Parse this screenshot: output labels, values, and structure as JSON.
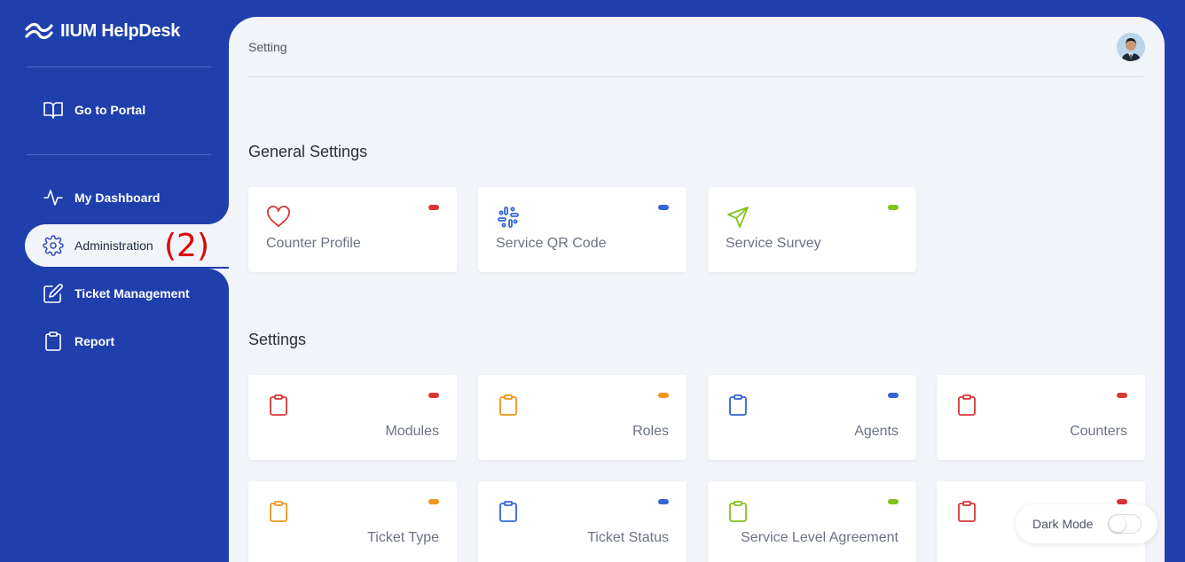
{
  "app": {
    "title": "IIUM HelpDesk"
  },
  "sidebar": {
    "items": [
      {
        "label": "Go to Portal",
        "icon": "book-open-icon"
      },
      {
        "label": "My Dashboard",
        "icon": "activity-icon"
      },
      {
        "label": "Administration",
        "icon": "gear-icon",
        "active": true,
        "annotation": "(2)"
      },
      {
        "label": "Ticket Management",
        "icon": "edit-icon"
      },
      {
        "label": "Report",
        "icon": "clipboard-icon"
      }
    ]
  },
  "header": {
    "breadcrumb": "Setting"
  },
  "general_settings": {
    "title": "General Settings",
    "cards": [
      {
        "label": "Counter Profile",
        "icon": "heart-icon",
        "color": "#d93636"
      },
      {
        "label": "Service QR Code",
        "icon": "qr-icon",
        "color": "#3564d6"
      },
      {
        "label": "Service Survey",
        "icon": "send-icon",
        "color": "#84c21d"
      }
    ]
  },
  "settings": {
    "title": "Settings",
    "cards": [
      {
        "label": "Modules",
        "icon": "clipboard-icon",
        "color": "#d93636"
      },
      {
        "label": "Roles",
        "icon": "clipboard-icon",
        "color": "#f0961e"
      },
      {
        "label": "Agents",
        "icon": "clipboard-icon",
        "color": "#3564d6"
      },
      {
        "label": "Counters",
        "icon": "clipboard-icon",
        "color": "#d93636"
      },
      {
        "label": "Ticket Type",
        "icon": "clipboard-icon",
        "color": "#f0961e"
      },
      {
        "label": "Ticket Status",
        "icon": "clipboard-icon",
        "color": "#3564d6"
      },
      {
        "label": "Service Level Agreement",
        "icon": "clipboard-icon",
        "color": "#84c21d"
      },
      {
        "label": "",
        "icon": "clipboard-icon",
        "color": "#d93636"
      }
    ]
  },
  "dark_mode": {
    "label": "Dark Mode",
    "enabled": false
  }
}
